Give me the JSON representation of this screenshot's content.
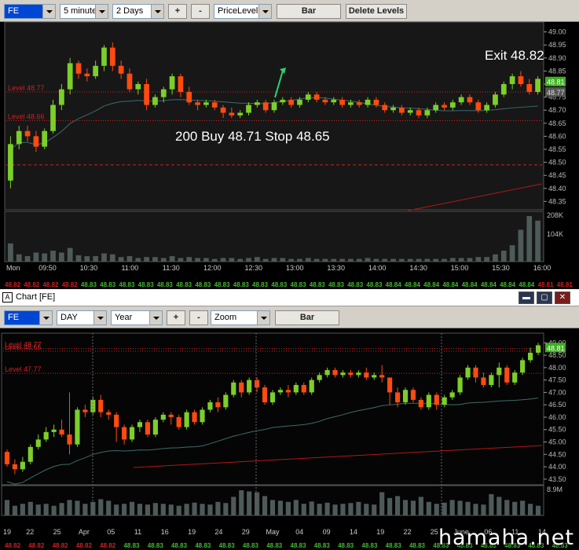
{
  "top_toolbar": {
    "symbol": "FE",
    "interval": "5 minutes",
    "range": "2 Days",
    "plus": "+",
    "minus": "-",
    "study": "PriceLevel",
    "bar_button": "Bar",
    "delete_button": "Delete Levels"
  },
  "window": {
    "title": "Chart [FE]",
    "icon": "A",
    "min": "▬",
    "max": "▢",
    "close": "✕"
  },
  "bottom_toolbar": {
    "symbol": "FE",
    "interval": "DAY",
    "range": "Year",
    "plus": "+",
    "minus": "-",
    "study": "Zoom",
    "bar_button": "Bar"
  },
  "watermark": "hamaha.net",
  "colors": {
    "up": "#7ccf2a",
    "down": "#ff4a10",
    "level": "#cc2222",
    "ma_slow": "#3d6b6b",
    "ma_red": "#b01818",
    "volume": "#4e5a5a",
    "last": "#3fb020"
  },
  "chart_data": [
    {
      "type": "candlestick",
      "interval": "5 minutes",
      "y_ticks": [
        "49.00",
        "48.95",
        "48.90",
        "48.85",
        "48.80",
        "48.75",
        "48.70",
        "48.65",
        "48.60",
        "48.55",
        "48.50",
        "48.45",
        "48.40",
        "48.35"
      ],
      "ylim": [
        48.33,
        49.02
      ],
      "x_ticks": [
        "Mon",
        "09:50",
        "10:30",
        "11:00",
        "11:30",
        "12:00",
        "12:30",
        "13:00",
        "13:30",
        "14:00",
        "14:30",
        "15:00",
        "15:30",
        "16:00"
      ],
      "levels": [
        {
          "name": "Level 48.77",
          "value": 48.77,
          "style": "dotted"
        },
        {
          "name": "Level 48.66",
          "value": 48.66,
          "style": "dotted"
        },
        {
          "name": "",
          "value": 48.49,
          "style": "dashed"
        }
      ],
      "price_labels": [
        "48.81",
        "48.77"
      ],
      "annotations": {
        "entry": "200 Buy  48.71  Stop 48.65",
        "exit": "Exit 48.82"
      },
      "volume_ticks": [
        "208K",
        "104K"
      ],
      "bid_ask_strip": [
        "48.82",
        "48.82",
        "48.82",
        "48.82",
        "48.83",
        "48.83",
        "48.83",
        "48.83",
        "48.83",
        "48.83",
        "48.83",
        "48.83",
        "48.83",
        "48.83",
        "48.83",
        "48.83",
        "48.83",
        "48.83",
        "48.83",
        "48.83",
        "48.84",
        "48.84",
        "48.84",
        "48.84",
        "48.84",
        "48.84",
        "48.84",
        "48.84",
        "48.81",
        "48.81"
      ],
      "candles": [
        [
          48.43,
          48.57,
          48.4,
          48.6
        ],
        [
          48.57,
          48.62,
          48.55,
          48.64
        ],
        [
          48.62,
          48.6,
          48.58,
          48.64
        ],
        [
          48.6,
          48.56,
          48.54,
          48.62
        ],
        [
          48.56,
          48.62,
          48.55,
          48.63
        ],
        [
          48.62,
          48.72,
          48.61,
          48.74
        ],
        [
          48.72,
          48.78,
          48.7,
          48.8
        ],
        [
          48.78,
          48.88,
          48.76,
          48.9
        ],
        [
          48.88,
          48.84,
          48.82,
          48.89
        ],
        [
          48.84,
          48.83,
          48.81,
          48.86
        ],
        [
          48.83,
          48.87,
          48.82,
          48.89
        ],
        [
          48.87,
          48.94,
          48.85,
          48.95
        ],
        [
          48.94,
          48.87,
          48.85,
          48.96
        ],
        [
          48.87,
          48.84,
          48.82,
          48.89
        ],
        [
          48.84,
          48.78,
          48.77,
          48.86
        ],
        [
          48.78,
          48.8,
          48.76,
          48.81
        ],
        [
          48.8,
          48.72,
          48.7,
          48.82
        ],
        [
          48.72,
          48.75,
          48.71,
          48.76
        ],
        [
          48.75,
          48.78,
          48.73,
          48.79
        ],
        [
          48.78,
          48.83,
          48.76,
          48.84
        ],
        [
          48.83,
          48.77,
          48.75,
          48.84
        ],
        [
          48.77,
          48.73,
          48.72,
          48.79
        ],
        [
          48.73,
          48.72,
          48.7,
          48.74
        ],
        [
          48.72,
          48.73,
          48.71,
          48.74
        ],
        [
          48.73,
          48.71,
          48.7,
          48.74
        ],
        [
          48.71,
          48.69,
          48.67,
          48.72
        ],
        [
          48.69,
          48.68,
          48.67,
          48.71
        ],
        [
          48.68,
          48.69,
          48.67,
          48.7
        ],
        [
          48.69,
          48.72,
          48.68,
          48.73
        ],
        [
          48.72,
          48.73,
          48.71,
          48.74
        ],
        [
          48.73,
          48.7,
          48.69,
          48.74
        ],
        [
          48.7,
          48.73,
          48.69,
          48.74
        ],
        [
          48.73,
          48.74,
          48.72,
          48.75
        ],
        [
          48.74,
          48.72,
          48.71,
          48.75
        ],
        [
          48.72,
          48.74,
          48.71,
          48.75
        ],
        [
          48.74,
          48.76,
          48.73,
          48.77
        ],
        [
          48.76,
          48.74,
          48.73,
          48.77
        ],
        [
          48.74,
          48.73,
          48.72,
          48.75
        ],
        [
          48.73,
          48.74,
          48.72,
          48.75
        ],
        [
          48.74,
          48.72,
          48.71,
          48.75
        ],
        [
          48.72,
          48.73,
          48.71,
          48.74
        ],
        [
          48.73,
          48.72,
          48.71,
          48.74
        ],
        [
          48.72,
          48.74,
          48.71,
          48.75
        ],
        [
          48.74,
          48.72,
          48.71,
          48.75
        ],
        [
          48.72,
          48.7,
          48.69,
          48.73
        ],
        [
          48.7,
          48.71,
          48.69,
          48.72
        ],
        [
          48.71,
          48.69,
          48.68,
          48.72
        ],
        [
          48.69,
          48.7,
          48.68,
          48.71
        ],
        [
          48.7,
          48.68,
          48.67,
          48.71
        ],
        [
          48.68,
          48.7,
          48.67,
          48.71
        ],
        [
          48.7,
          48.72,
          48.69,
          48.73
        ],
        [
          48.72,
          48.71,
          48.7,
          48.73
        ],
        [
          48.71,
          48.73,
          48.7,
          48.74
        ],
        [
          48.73,
          48.75,
          48.72,
          48.76
        ],
        [
          48.75,
          48.73,
          48.72,
          48.76
        ],
        [
          48.73,
          48.7,
          48.69,
          48.74
        ],
        [
          48.7,
          48.72,
          48.69,
          48.73
        ],
        [
          48.72,
          48.76,
          48.71,
          48.77
        ],
        [
          48.76,
          48.8,
          48.75,
          48.81
        ],
        [
          48.8,
          48.83,
          48.78,
          48.84
        ],
        [
          48.83,
          48.8,
          48.79,
          48.85
        ],
        [
          48.8,
          48.77,
          48.76,
          48.82
        ],
        [
          48.77,
          48.82,
          48.76,
          48.83
        ]
      ],
      "volume": [
        20,
        8,
        6,
        10,
        9,
        12,
        10,
        15,
        7,
        6,
        6,
        9,
        8,
        5,
        6,
        4,
        5,
        5,
        4,
        6,
        4,
        5,
        4,
        4,
        3,
        4,
        4,
        3,
        4,
        5,
        3,
        4,
        4,
        3,
        3,
        4,
        3,
        3,
        3,
        3,
        3,
        3,
        4,
        3,
        3,
        3,
        3,
        3,
        3,
        3,
        3,
        3,
        4,
        4,
        4,
        5,
        5,
        8,
        12,
        18,
        35,
        50,
        45
      ]
    },
    {
      "type": "candlestick",
      "interval": "DAY",
      "y_ticks": [
        "49.00",
        "48.50",
        "48.00",
        "47.50",
        "47.00",
        "46.50",
        "46.00",
        "45.50",
        "45.00",
        "44.50",
        "44.00",
        "43.50"
      ],
      "ylim": [
        43.4,
        49.2
      ],
      "x_ticks": [
        "19",
        "22",
        "25",
        "Apr",
        "05",
        "11",
        "16",
        "19",
        "24",
        "29",
        "May",
        "04",
        "09",
        "14",
        "19",
        "22",
        "25",
        "June",
        "06",
        "11",
        "14"
      ],
      "levels": [
        {
          "name": "Level 48.77",
          "value": 48.77,
          "style": "dotted"
        },
        {
          "name": "Level 48.66",
          "value": 48.66,
          "style": "dotted"
        },
        {
          "name": "Level 47.77",
          "value": 47.77,
          "style": "dotted"
        }
      ],
      "price_labels": [
        "48.81"
      ],
      "volume_ticks": [
        "8.9M"
      ],
      "bid_ask_strip": [
        "48.82",
        "48.82",
        "48.82",
        "48.82",
        "48.82",
        "48.83",
        "48.83",
        "48.83",
        "48.83",
        "48.83",
        "48.83",
        "48.83",
        "48.83",
        "48.83",
        "48.83",
        "48.83",
        "48.83",
        "48.83",
        "48.83",
        "48.83",
        "48.83",
        "48.83",
        "48.83",
        "48.83"
      ],
      "candles": [
        [
          44.6,
          44.1,
          44.0,
          44.7
        ],
        [
          44.1,
          43.9,
          43.7,
          44.3
        ],
        [
          43.9,
          44.2,
          43.8,
          44.4
        ],
        [
          44.2,
          44.8,
          44.1,
          44.9
        ],
        [
          44.8,
          45.1,
          44.7,
          45.3
        ],
        [
          45.1,
          45.4,
          45.0,
          45.6
        ],
        [
          45.4,
          45.5,
          45.2,
          45.7
        ],
        [
          45.5,
          45.3,
          45.2,
          45.9
        ],
        [
          45.3,
          44.9,
          44.5,
          47.0
        ],
        [
          44.9,
          46.3,
          44.8,
          46.4
        ],
        [
          46.3,
          46.2,
          46.0,
          46.5
        ],
        [
          46.2,
          46.7,
          46.1,
          46.8
        ],
        [
          46.7,
          46.2,
          46.0,
          46.9
        ],
        [
          46.2,
          46.1,
          45.9,
          46.3
        ],
        [
          46.1,
          45.6,
          45.0,
          46.2
        ],
        [
          45.6,
          45.1,
          44.9,
          45.7
        ],
        [
          45.1,
          45.6,
          45.0,
          45.7
        ],
        [
          45.6,
          45.8,
          45.4,
          45.9
        ],
        [
          45.8,
          45.3,
          45.2,
          45.9
        ],
        [
          45.3,
          45.9,
          45.2,
          46.0
        ],
        [
          45.9,
          46.1,
          45.8,
          46.2
        ],
        [
          46.1,
          46.0,
          45.7,
          46.2
        ],
        [
          46.0,
          45.6,
          45.5,
          46.1
        ],
        [
          45.6,
          46.2,
          45.5,
          46.3
        ],
        [
          46.2,
          45.8,
          45.7,
          46.3
        ],
        [
          45.8,
          46.3,
          45.7,
          46.4
        ],
        [
          46.3,
          46.6,
          46.2,
          46.7
        ],
        [
          46.6,
          46.4,
          46.2,
          46.8
        ],
        [
          46.4,
          46.9,
          46.3,
          47.0
        ],
        [
          46.9,
          47.4,
          46.8,
          47.5
        ],
        [
          47.4,
          47.0,
          46.8,
          47.5
        ],
        [
          47.0,
          47.5,
          46.9,
          47.6
        ],
        [
          47.5,
          47.2,
          47.0,
          47.6
        ],
        [
          47.2,
          46.6,
          46.5,
          47.3
        ],
        [
          46.6,
          47.0,
          46.5,
          47.1
        ],
        [
          47.0,
          47.1,
          46.9,
          47.2
        ],
        [
          47.1,
          47.0,
          46.8,
          47.3
        ],
        [
          47.0,
          47.3,
          46.9,
          47.4
        ],
        [
          47.3,
          47.0,
          46.9,
          47.4
        ],
        [
          47.0,
          47.5,
          46.9,
          47.6
        ],
        [
          47.5,
          47.7,
          47.4,
          47.8
        ],
        [
          47.7,
          47.9,
          47.6,
          48.0
        ],
        [
          47.9,
          47.7,
          47.6,
          48.0
        ],
        [
          47.7,
          47.8,
          47.6,
          47.9
        ],
        [
          47.8,
          47.7,
          47.6,
          47.9
        ],
        [
          47.7,
          47.8,
          47.6,
          47.9
        ],
        [
          47.8,
          47.6,
          47.5,
          48.0
        ],
        [
          47.6,
          47.7,
          47.5,
          47.8
        ],
        [
          47.7,
          47.6,
          47.4,
          48.1
        ],
        [
          47.6,
          47.0,
          46.5,
          47.2
        ],
        [
          47.0,
          46.6,
          46.4,
          47.2
        ],
        [
          46.6,
          47.1,
          46.5,
          47.2
        ],
        [
          47.1,
          46.7,
          46.6,
          47.2
        ],
        [
          46.7,
          46.4,
          46.3,
          46.8
        ],
        [
          46.4,
          46.9,
          46.3,
          47.0
        ],
        [
          46.9,
          46.5,
          46.3,
          47.0
        ],
        [
          46.5,
          46.8,
          46.4,
          46.9
        ],
        [
          46.8,
          47.0,
          46.7,
          47.1
        ],
        [
          47.0,
          47.6,
          46.9,
          47.7
        ],
        [
          47.6,
          48.0,
          47.5,
          48.1
        ],
        [
          48.0,
          47.6,
          47.4,
          48.1
        ],
        [
          47.6,
          47.3,
          47.2,
          47.8
        ],
        [
          47.3,
          47.7,
          47.2,
          47.8
        ],
        [
          47.7,
          48.0,
          47.2,
          48.2
        ],
        [
          48.0,
          47.4,
          47.3,
          48.1
        ],
        [
          47.4,
          47.8,
          47.3,
          47.9
        ],
        [
          47.8,
          48.3,
          47.7,
          48.4
        ],
        [
          48.3,
          48.6,
          48.2,
          48.8
        ],
        [
          48.6,
          48.9,
          48.5,
          49.0
        ]
      ],
      "volume": [
        40,
        25,
        30,
        35,
        28,
        30,
        25,
        32,
        40,
        38,
        30,
        35,
        42,
        38,
        28,
        30,
        35,
        30,
        28,
        32,
        30,
        28,
        25,
        30,
        33,
        30,
        28,
        35,
        32,
        48,
        65,
        62,
        60,
        50,
        40,
        38,
        35,
        40,
        30,
        36,
        30,
        33,
        28,
        30,
        32,
        35,
        30,
        28,
        60,
        45,
        50,
        40,
        38,
        48,
        35,
        30,
        33,
        40,
        38,
        35,
        30,
        28,
        55,
        48,
        40,
        35,
        38,
        30,
        25
      ]
    }
  ]
}
